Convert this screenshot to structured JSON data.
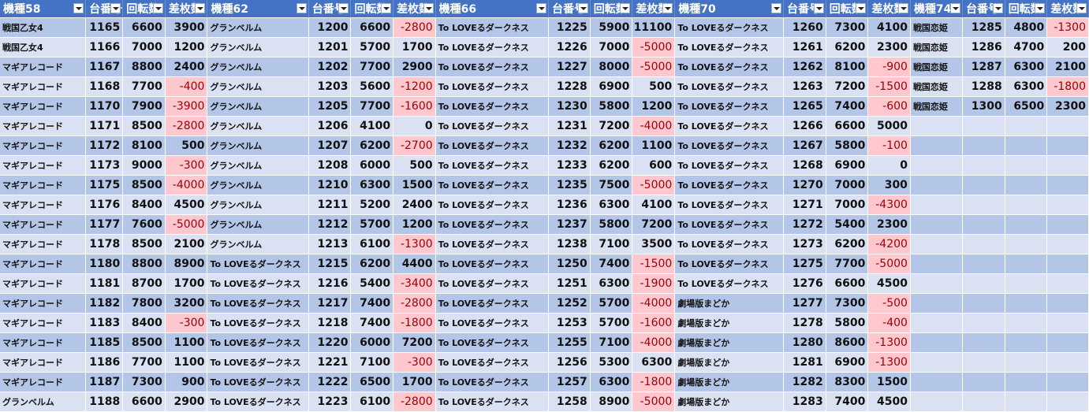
{
  "headers": [
    "機種58",
    "台番号",
    "回転数",
    "差枚数",
    "機種62",
    "台番号",
    "回転数",
    "差枚数",
    "機種66",
    "台番号",
    "回転数",
    "差枚数",
    "機種70",
    "台番号",
    "回転数",
    "差枚数",
    "機種74",
    "台番号",
    "回転数",
    "差枚数"
  ],
  "rows": [
    [
      "戦国乙女4",
      "1165",
      "6600",
      "3900",
      "グランベルム",
      "1200",
      "6600",
      "-2800",
      "To LOVEるダークネス",
      "1225",
      "5900",
      "11100",
      "To LOVEるダークネス",
      "1260",
      "7300",
      "4100",
      "戦国恋姫",
      "1285",
      "4800",
      "-1300"
    ],
    [
      "戦国乙女4",
      "1166",
      "7000",
      "1200",
      "グランベルム",
      "1201",
      "5700",
      "1700",
      "To LOVEるダークネス",
      "1226",
      "7000",
      "-5000",
      "To LOVEるダークネス",
      "1261",
      "6200",
      "2300",
      "戦国恋姫",
      "1286",
      "4700",
      "200"
    ],
    [
      "マギアレコード",
      "1167",
      "8800",
      "2400",
      "グランベルム",
      "1202",
      "7700",
      "2900",
      "To LOVEるダークネス",
      "1227",
      "8000",
      "-5000",
      "To LOVEるダークネス",
      "1262",
      "8100",
      "-900",
      "戦国恋姫",
      "1287",
      "6300",
      "2100"
    ],
    [
      "マギアレコード",
      "1168",
      "7700",
      "-400",
      "グランベルム",
      "1203",
      "5600",
      "-1200",
      "To LOVEるダークネス",
      "1228",
      "6900",
      "500",
      "To LOVEるダークネス",
      "1263",
      "7200",
      "-1500",
      "戦国恋姫",
      "1288",
      "6300",
      "-1800"
    ],
    [
      "マギアレコード",
      "1170",
      "7900",
      "-3900",
      "グランベルム",
      "1205",
      "7700",
      "-1600",
      "To LOVEるダークネス",
      "1230",
      "5800",
      "1200",
      "To LOVEるダークネス",
      "1265",
      "7400",
      "-600",
      "戦国恋姫",
      "1300",
      "6500",
      "2300"
    ],
    [
      "マギアレコード",
      "1171",
      "8500",
      "-2800",
      "グランベルム",
      "1206",
      "4100",
      "0",
      "To LOVEるダークネス",
      "1231",
      "7200",
      "-4000",
      "To LOVEるダークネス",
      "1266",
      "6600",
      "5000",
      "",
      "",
      "",
      ""
    ],
    [
      "マギアレコード",
      "1172",
      "8100",
      "500",
      "グランベルム",
      "1207",
      "6200",
      "-2700",
      "To LOVEるダークネス",
      "1232",
      "6200",
      "1100",
      "To LOVEるダークネス",
      "1267",
      "5800",
      "-100",
      "",
      "",
      "",
      ""
    ],
    [
      "マギアレコード",
      "1173",
      "9000",
      "-300",
      "グランベルム",
      "1208",
      "6000",
      "500",
      "To LOVEるダークネス",
      "1233",
      "6200",
      "600",
      "To LOVEるダークネス",
      "1268",
      "6900",
      "0",
      "",
      "",
      "",
      ""
    ],
    [
      "マギアレコード",
      "1175",
      "8500",
      "-4000",
      "グランベルム",
      "1210",
      "6300",
      "1500",
      "To LOVEるダークネス",
      "1235",
      "7500",
      "-5000",
      "To LOVEるダークネス",
      "1270",
      "7000",
      "300",
      "",
      "",
      "",
      ""
    ],
    [
      "マギアレコード",
      "1176",
      "8400",
      "4500",
      "グランベルム",
      "1211",
      "5200",
      "2400",
      "To LOVEるダークネス",
      "1236",
      "6300",
      "4100",
      "To LOVEるダークネス",
      "1271",
      "7000",
      "-4300",
      "",
      "",
      "",
      ""
    ],
    [
      "マギアレコード",
      "1177",
      "7600",
      "-5000",
      "グランベルム",
      "1212",
      "5700",
      "1200",
      "To LOVEるダークネス",
      "1237",
      "5800",
      "7200",
      "To LOVEるダークネス",
      "1272",
      "5400",
      "2300",
      "",
      "",
      "",
      ""
    ],
    [
      "マギアレコード",
      "1178",
      "8500",
      "2100",
      "グランベルム",
      "1213",
      "6100",
      "-1300",
      "To LOVEるダークネス",
      "1238",
      "7100",
      "3500",
      "To LOVEるダークネス",
      "1273",
      "6200",
      "-4200",
      "",
      "",
      "",
      ""
    ],
    [
      "マギアレコード",
      "1180",
      "8800",
      "8900",
      "To LOVEるダークネス",
      "1215",
      "6200",
      "4400",
      "To LOVEるダークネス",
      "1250",
      "7400",
      "-1500",
      "To LOVEるダークネス",
      "1275",
      "7700",
      "-5000",
      "",
      "",
      "",
      ""
    ],
    [
      "マギアレコード",
      "1181",
      "8700",
      "1700",
      "To LOVEるダークネス",
      "1216",
      "5400",
      "-3400",
      "To LOVEるダークネス",
      "1251",
      "6300",
      "-1900",
      "To LOVEるダークネス",
      "1276",
      "6600",
      "4500",
      "",
      "",
      "",
      ""
    ],
    [
      "マギアレコード",
      "1182",
      "7800",
      "3200",
      "To LOVEるダークネス",
      "1217",
      "7400",
      "-2800",
      "To LOVEるダークネス",
      "1252",
      "5700",
      "-4000",
      "劇場版まどか",
      "1277",
      "7300",
      "-500",
      "",
      "",
      "",
      ""
    ],
    [
      "マギアレコード",
      "1183",
      "8400",
      "-300",
      "To LOVEるダークネス",
      "1218",
      "7400",
      "-1800",
      "To LOVEるダークネス",
      "1253",
      "5700",
      "-1600",
      "劇場版まどか",
      "1278",
      "5800",
      "-400",
      "",
      "",
      "",
      ""
    ],
    [
      "マギアレコード",
      "1185",
      "8500",
      "1100",
      "To LOVEるダークネス",
      "1220",
      "6000",
      "7200",
      "To LOVEるダークネス",
      "1255",
      "7100",
      "-4000",
      "劇場版まどか",
      "1280",
      "8600",
      "-1300",
      "",
      "",
      "",
      ""
    ],
    [
      "マギアレコード",
      "1186",
      "7700",
      "1100",
      "To LOVEるダークネス",
      "1221",
      "7100",
      "-300",
      "To LOVEるダークネス",
      "1256",
      "5300",
      "6300",
      "劇場版まどか",
      "1281",
      "6900",
      "-1300",
      "",
      "",
      "",
      ""
    ],
    [
      "マギアレコード",
      "1187",
      "7300",
      "900",
      "To LOVEるダークネス",
      "1222",
      "6500",
      "1700",
      "To LOVEるダークネス",
      "1257",
      "6300",
      "-1800",
      "劇場版まどか",
      "1282",
      "8300",
      "1500",
      "",
      "",
      "",
      ""
    ],
    [
      "グランベルム",
      "1188",
      "6600",
      "2900",
      "To LOVEるダークネス",
      "1223",
      "6100",
      "-2800",
      "To LOVEるダークネス",
      "1258",
      "8900",
      "-5000",
      "劇場版まどか",
      "1283",
      "7400",
      "4500",
      "",
      "",
      "",
      ""
    ]
  ],
  "colors": {
    "header_bg": "#4472c4",
    "row_odd": "#b4c6e7",
    "row_even": "#d9e1f2",
    "negative_bg": "#ffc7ce",
    "negative_text": "#9c0006"
  },
  "icons": {
    "filter_button": "dropdown-filter-icon"
  }
}
